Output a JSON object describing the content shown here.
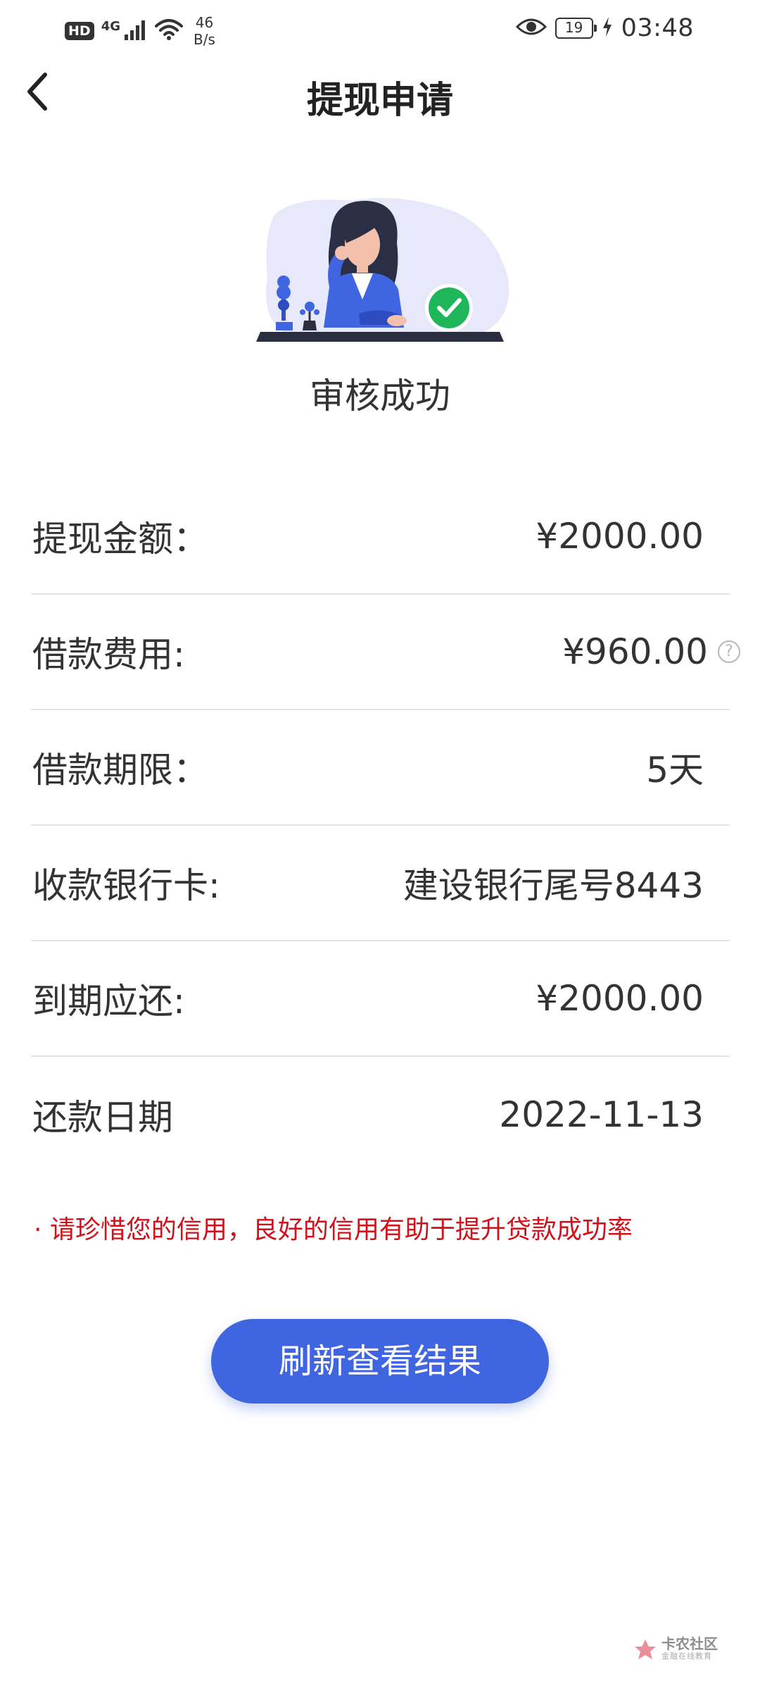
{
  "status_bar": {
    "hd": "HD",
    "network_type": "4G",
    "speed_value": "46",
    "speed_unit": "B/s",
    "battery_level": "19",
    "time": "03:48"
  },
  "header": {
    "title": "提现申请"
  },
  "result": {
    "title": "审核成功"
  },
  "details": [
    {
      "label": "提现金额：",
      "value": "¥2000.00"
    },
    {
      "label": "借款费用:",
      "value": "¥960.00"
    },
    {
      "label": "借款期限：",
      "value": "5天"
    },
    {
      "label": "收款银行卡:",
      "value": "建设银行尾号8443"
    },
    {
      "label": "到期应还:",
      "value": "¥2000.00"
    },
    {
      "label": "还款日期",
      "value": "2022-11-13"
    }
  ],
  "tip": "· 请珍惜您的信用，良好的信用有助于提升贷款成功率",
  "button": {
    "refresh_label": "刷新查看结果"
  },
  "watermark": {
    "main": "卡农社区",
    "sub": "金融在线教育"
  },
  "colors": {
    "primary": "#3f66e0",
    "tip_red": "#d0121b",
    "success_green": "#1fb65a"
  }
}
